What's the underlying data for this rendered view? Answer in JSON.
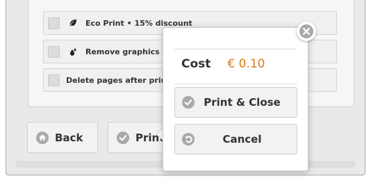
{
  "options": [
    {
      "label": "Eco Print • 15% discount",
      "icon": "leaf-icon"
    },
    {
      "label": "Remove graphics",
      "icon": "drops-icon"
    },
    {
      "label": "Delete pages after print",
      "icon": ""
    }
  ],
  "buttons": {
    "back": {
      "label": "Back",
      "icon": "home-icon"
    },
    "print": {
      "label": "Print",
      "icon": "check-icon"
    }
  },
  "popover": {
    "cost_label": "Cost",
    "cost_value": "€ 0.10",
    "print_close": {
      "label": "Print & Close",
      "icon": "check-icon"
    },
    "cancel": {
      "label": "Cancel",
      "icon": "undo-icon"
    }
  },
  "colors": {
    "accent": "#e07a16",
    "icon_gray": "#a9a9a9"
  }
}
